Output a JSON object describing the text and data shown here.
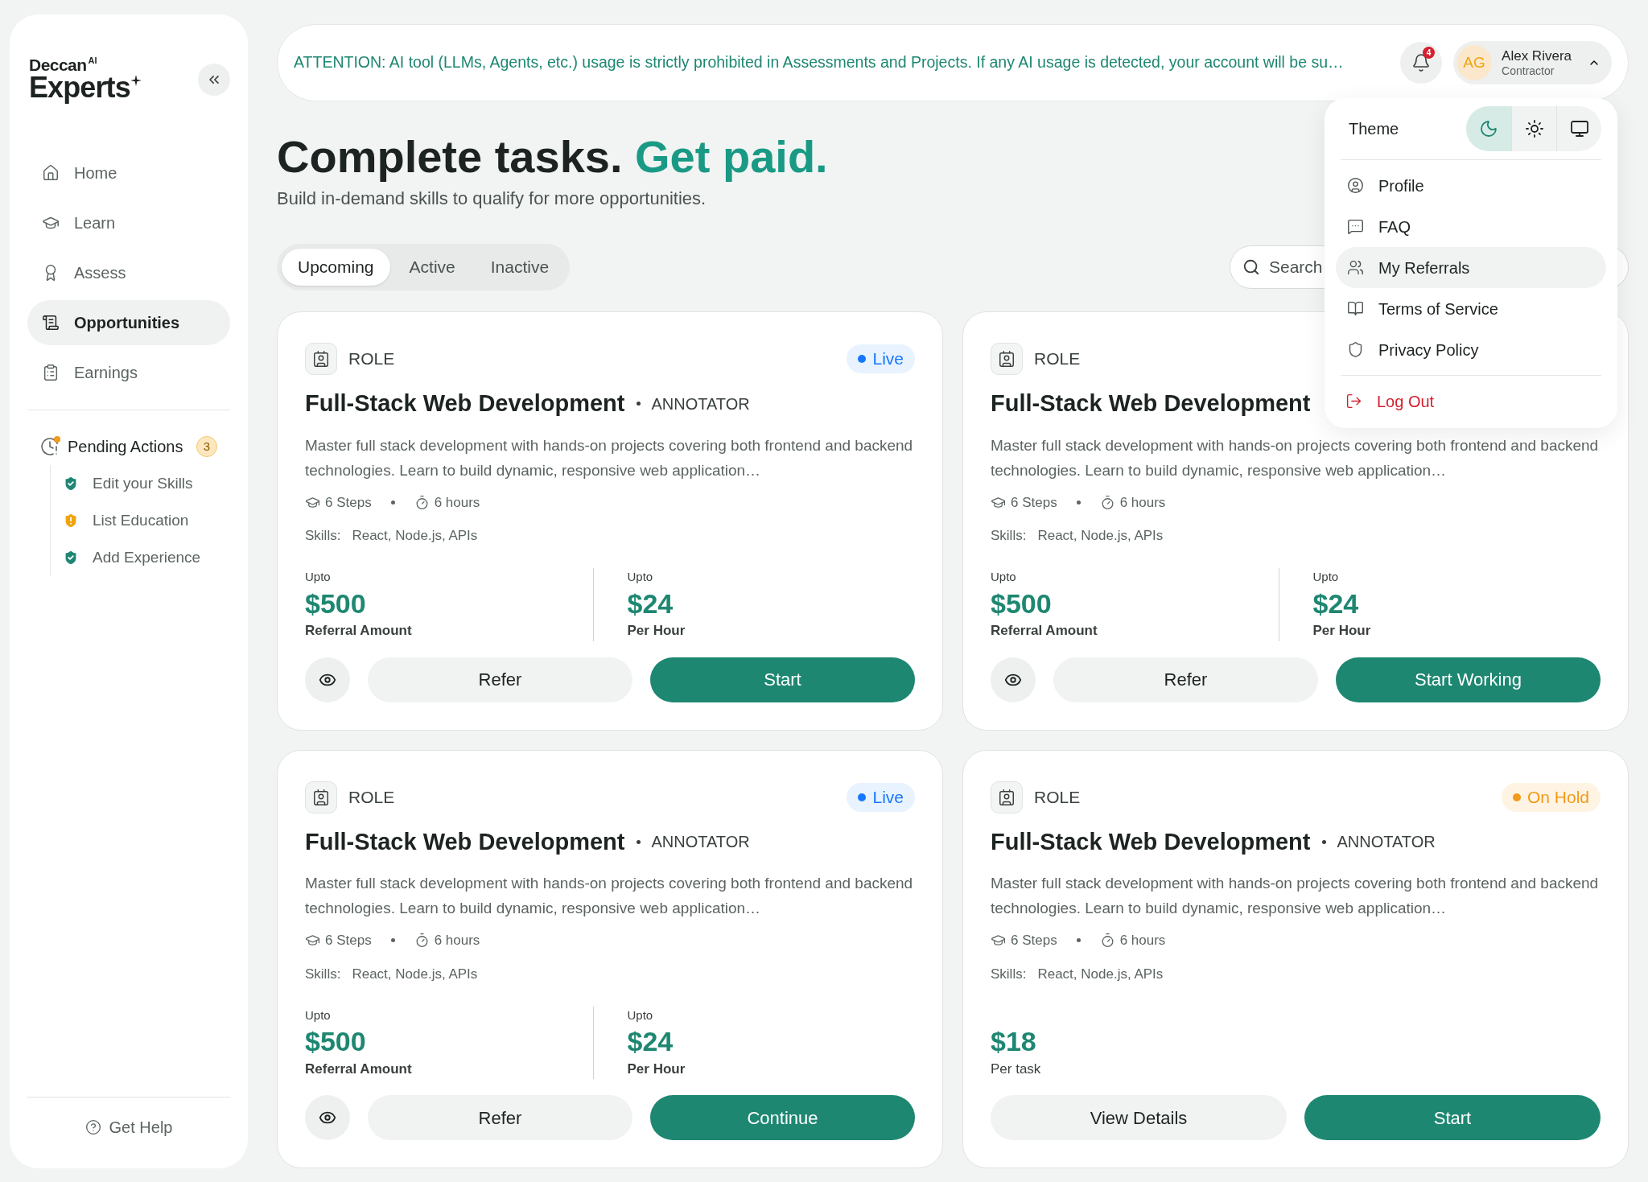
{
  "sidebar": {
    "logo": {
      "line1": "Deccan",
      "sup": "AI",
      "line2": "Experts"
    },
    "nav": [
      {
        "label": "Home",
        "selected": false
      },
      {
        "label": "Learn",
        "selected": false
      },
      {
        "label": "Assess",
        "selected": false
      },
      {
        "label": "Opportunities",
        "selected": true
      },
      {
        "label": "Earnings",
        "selected": false
      }
    ],
    "pending": {
      "label": "Pending Actions",
      "count": "3",
      "items": [
        {
          "label": "Edit your Skills",
          "kind": "done"
        },
        {
          "label": "List Education",
          "kind": "warning"
        },
        {
          "label": "Add Experience",
          "kind": "done"
        }
      ]
    },
    "help": "Get Help"
  },
  "banner": {
    "text": "ATTENTION: AI tool (LLMs, Agents, etc.) usage is strictly prohibited in Assessments and Projects. If any AI usage is detected, your account will be su…"
  },
  "notifications": {
    "count": "4"
  },
  "user": {
    "initials": "AG",
    "name": "Alex Rivera",
    "role": "Contractor",
    "expanded": true
  },
  "hero": {
    "title": "Complete tasks.",
    "accent": "Get paid.",
    "subtitle": "Build in-demand skills to qualify for more opportunities."
  },
  "tabs": [
    {
      "label": "Upcoming",
      "selected": true
    },
    {
      "label": "Active",
      "selected": false
    },
    {
      "label": "Inactive",
      "selected": false
    }
  ],
  "search": {
    "placeholder": "Search"
  },
  "menu": {
    "theme_label": "Theme",
    "themes": [
      {
        "kind": "dark",
        "selected": true
      },
      {
        "kind": "light",
        "selected": false
      },
      {
        "kind": "system",
        "selected": false
      }
    ],
    "items": [
      {
        "label": "Profile",
        "kind": "profile",
        "selected": false
      },
      {
        "label": "FAQ",
        "kind": "faq",
        "selected": false
      },
      {
        "label": "My Referrals",
        "kind": "referrals",
        "selected": true
      },
      {
        "label": "Terms of Service",
        "kind": "terms",
        "selected": false
      },
      {
        "label": "Privacy Policy",
        "kind": "privacy",
        "selected": false
      },
      {
        "label": "Log Out",
        "kind": "logout",
        "selected": false
      }
    ]
  },
  "cards": [
    {
      "kind": "referral",
      "role_label": "ROLE",
      "status": {
        "kind": "live",
        "label": "Live"
      },
      "title": "Full-Stack Web Development",
      "role_type": "ANNOTATOR",
      "description": "Master full stack development with hands-on projects covering both frontend and backend technologies. Learn to build dynamic, responsive web application…",
      "steps": "6 Steps",
      "duration": "6 hours",
      "skills_label": "Skills:",
      "skills": "React, Node.js, APIs",
      "pay": [
        {
          "prefix": "Upto",
          "amount": "$500",
          "caption": "Referral Amount"
        },
        {
          "prefix": "Upto",
          "amount": "$24",
          "caption": "Per Hour"
        }
      ],
      "buttons": [
        {
          "kind": "view"
        },
        {
          "kind": "secondary",
          "label": "Refer"
        },
        {
          "kind": "primary",
          "label": "Start"
        }
      ]
    },
    {
      "kind": "referral",
      "role_label": "ROLE",
      "title": "Full-Stack Web Development",
      "description": "Master full stack development with hands-on projects covering both frontend and backend technologies. Learn to build dynamic, responsive web application…",
      "steps": "6 Steps",
      "duration": "6 hours",
      "skills_label": "Skills:",
      "skills": "React, Node.js, APIs",
      "pay": [
        {
          "prefix": "Upto",
          "amount": "$500",
          "caption": "Referral Amount"
        },
        {
          "prefix": "Upto",
          "amount": "$24",
          "caption": "Per Hour"
        }
      ],
      "buttons": [
        {
          "kind": "view"
        },
        {
          "kind": "secondary",
          "label": "Refer"
        },
        {
          "kind": "primary",
          "label": "Start Working"
        }
      ]
    },
    {
      "kind": "referral",
      "role_label": "ROLE",
      "status": {
        "kind": "live",
        "label": "Live"
      },
      "title": "Full-Stack Web Development",
      "role_type": "ANNOTATOR",
      "description": "Master full stack development with hands-on projects covering both frontend and backend technologies. Learn to build dynamic, responsive web application…",
      "steps": "6 Steps",
      "duration": "6 hours",
      "skills_label": "Skills:",
      "skills": "React, Node.js, APIs",
      "pay": [
        {
          "prefix": "Upto",
          "amount": "$500",
          "caption": "Referral Amount"
        },
        {
          "prefix": "Upto",
          "amount": "$24",
          "caption": "Per Hour"
        }
      ],
      "buttons": [
        {
          "kind": "view"
        },
        {
          "kind": "secondary",
          "label": "Refer"
        },
        {
          "kind": "primary",
          "label": "Continue"
        }
      ]
    },
    {
      "kind": "task",
      "role_label": "ROLE",
      "status": {
        "kind": "on_hold",
        "label": "On Hold"
      },
      "title": "Full-Stack Web Development",
      "role_type": "ANNOTATOR",
      "description": "Master full stack development with hands-on projects covering both frontend and backend technologies. Learn to build dynamic, responsive web application…",
      "steps": "6 Steps",
      "duration": "6 hours",
      "skills_label": "Skills:",
      "skills": "React, Node.js, APIs",
      "pay": [
        {
          "amount": "$18",
          "caption": "Per task"
        }
      ],
      "buttons": [
        {
          "kind": "secondary",
          "label": "View Details"
        },
        {
          "kind": "primary",
          "label": "Start"
        }
      ]
    }
  ]
}
